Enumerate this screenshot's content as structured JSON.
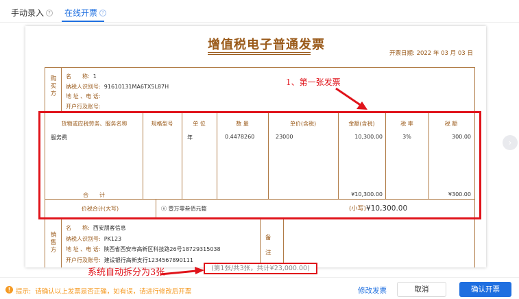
{
  "tabs": [
    {
      "label": "手动录入",
      "active": false
    },
    {
      "label": "在线开票",
      "active": true
    }
  ],
  "tab_help_icon": "question-circle-icon",
  "invoice": {
    "title": "增值税电子普通发票",
    "issue_date_label": "开票日期:",
    "issue_date": "2022 年 03 月 03 日",
    "buyer": {
      "side_label": "购买方",
      "name_label": "名　　称:",
      "name": "1",
      "tax_id_label": "纳税人识别号:",
      "tax_id": "91610131MA6TX5L87H",
      "address_label": "地 址 、电 话:",
      "address": "",
      "bank_label": "开户行及账号:",
      "bank": ""
    },
    "columns": [
      "货物或应税劳务、服务名称",
      "规格型号",
      "单 位",
      "数 量",
      "单价(含税)",
      "金额(含税)",
      "税 率",
      "税 额"
    ],
    "rows": [
      {
        "name": "服务费",
        "spec": "",
        "unit": "年",
        "qty": "0.4478260",
        "price": "23000",
        "amount": "10,300.00",
        "rate": "3%",
        "tax": "300.00"
      }
    ],
    "total_label": "合　　计",
    "total_amount": "¥10,300.00",
    "total_tax": "¥300.00",
    "total_words_label": "价税合计(大写)",
    "total_words": "ⓧ 壹万零叁佰元整",
    "total_small_label": "(小写)",
    "total_small": "¥10,300.00",
    "seller": {
      "side_label": "销售方",
      "name_label": "名　　称:",
      "name": "西安朋客信息",
      "tax_id_label": "纳税人识别号:",
      "tax_id": "PK123",
      "address_label": "地 址 、电 话:",
      "address": "陕西省西安市高新区科技路26号18729315038",
      "bank_label": "开户行及账号:",
      "bank": "建设银行高新支行1234567890111"
    },
    "remark_label_1": "备",
    "remark_label_2": "注"
  },
  "annotations": {
    "first_invoice": "1、第一张发票",
    "auto_split": "系统自动拆分为3张"
  },
  "pager_text": "(第1张/共3张，共计¥23,000.00)",
  "next_icon": "chevron-right-icon",
  "footer": {
    "tip_label": "提示:",
    "tip_text": "请确认以上发票是否正确，如有误，请进行修改后开票",
    "modify_label": "修改发票",
    "cancel_label": "取消",
    "confirm_label": "确认开票"
  },
  "colors": {
    "accent": "#1f6fe0",
    "annotation": "#e0141b",
    "invoice_brown": "#9a5a1a",
    "warning": "#f59a23"
  }
}
